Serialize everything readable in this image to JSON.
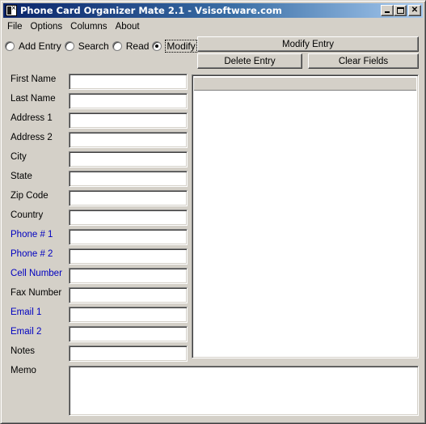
{
  "window": {
    "title": "Phone Card Organizer Mate 2.1 - Vsisoftware.com",
    "icon": "phone-card-app-icon",
    "controls": {
      "minimize": "minimize-icon",
      "maximize": "maximize-icon",
      "close": "close-icon",
      "close_glyph": "✕"
    }
  },
  "menubar": {
    "items": [
      {
        "label": "File"
      },
      {
        "label": "Options"
      },
      {
        "label": "Columns"
      },
      {
        "label": "About"
      }
    ]
  },
  "mode": {
    "options": [
      {
        "label": "Add Entry",
        "checked": false
      },
      {
        "label": "Search",
        "checked": false
      },
      {
        "label": "Read",
        "checked": false
      },
      {
        "label": "Modify",
        "checked": true
      }
    ],
    "selected": "Modify"
  },
  "actions": {
    "primary_label": "Modify Entry",
    "delete_label": "Delete Entry",
    "clear_label": "Clear Fields"
  },
  "form": {
    "fields": [
      {
        "label": "First Name",
        "value": "",
        "highlight": false
      },
      {
        "label": "Last Name",
        "value": "",
        "highlight": false
      },
      {
        "label": "Address 1",
        "value": "",
        "highlight": false
      },
      {
        "label": "Address 2",
        "value": "",
        "highlight": false
      },
      {
        "label": "City",
        "value": "",
        "highlight": false
      },
      {
        "label": "State",
        "value": "",
        "highlight": false
      },
      {
        "label": "Zip Code",
        "value": "",
        "highlight": false
      },
      {
        "label": "Country",
        "value": "",
        "highlight": false
      },
      {
        "label": "Phone # 1",
        "value": "",
        "highlight": true
      },
      {
        "label": "Phone # 2",
        "value": "",
        "highlight": true
      },
      {
        "label": "Cell Number",
        "value": "",
        "highlight": true
      },
      {
        "label": "Fax Number",
        "value": "",
        "highlight": false
      },
      {
        "label": "Email 1",
        "value": "",
        "highlight": true
      },
      {
        "label": "Email 2",
        "value": "",
        "highlight": true
      },
      {
        "label": "Notes",
        "value": "",
        "highlight": false
      }
    ],
    "memo": {
      "label": "Memo",
      "value": ""
    }
  },
  "results_list": {
    "columns": [],
    "rows": []
  },
  "colors": {
    "face": "#d4d0c8",
    "title_start": "#0a246a",
    "title_end": "#a6caf0",
    "highlight_label": "#0000c0"
  }
}
